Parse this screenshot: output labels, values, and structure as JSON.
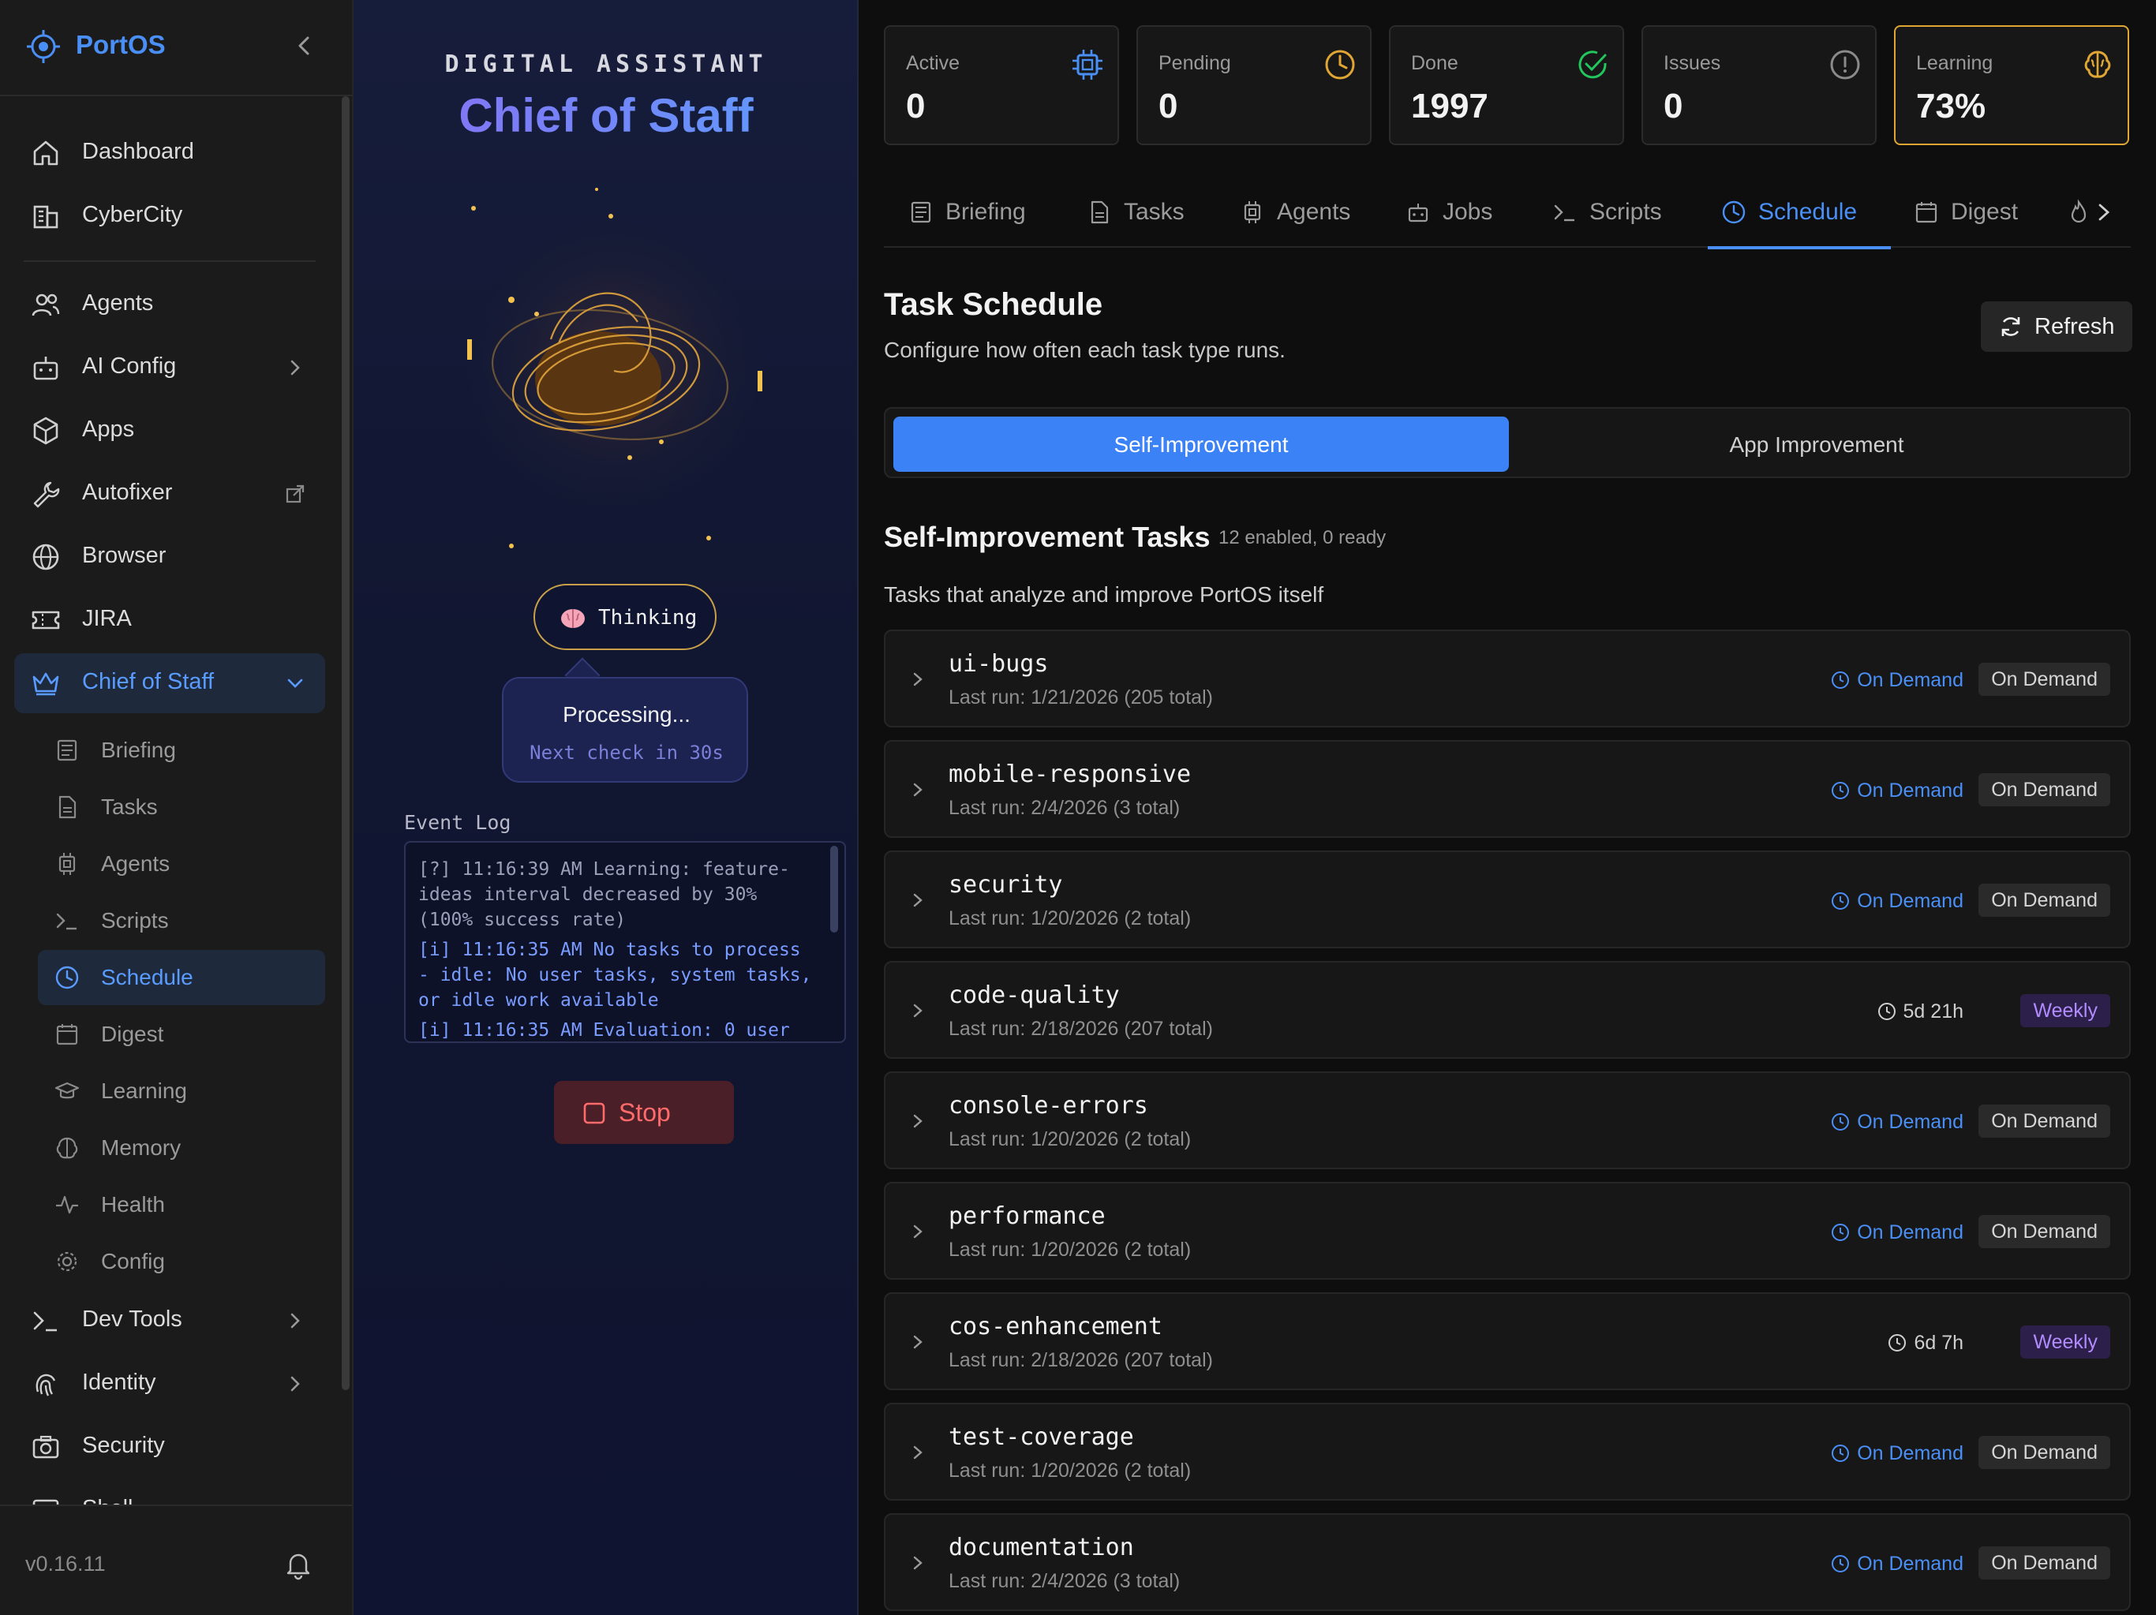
{
  "app": {
    "name": "PortOS",
    "version": "v0.16.11"
  },
  "sidebar": {
    "items": [
      {
        "label": "Dashboard",
        "icon": "home-icon"
      },
      {
        "label": "CyberCity",
        "icon": "building-icon"
      },
      {
        "label": "Agents",
        "icon": "users-icon"
      },
      {
        "label": "AI Config",
        "icon": "bot-icon"
      },
      {
        "label": "Apps",
        "icon": "package-icon"
      },
      {
        "label": "Autofixer",
        "icon": "wrench-icon"
      },
      {
        "label": "Browser",
        "icon": "globe-icon"
      },
      {
        "label": "JIRA",
        "icon": "ticket-icon"
      },
      {
        "label": "Chief of Staff",
        "icon": "crown-icon"
      },
      {
        "label": "Dev Tools",
        "icon": "terminal-icon"
      },
      {
        "label": "Identity",
        "icon": "fingerprint-icon"
      },
      {
        "label": "Security",
        "icon": "camera-icon"
      },
      {
        "label": "Shell",
        "icon": "terminal-window-icon"
      }
    ],
    "sub_items": [
      {
        "label": "Briefing",
        "icon": "newspaper-icon"
      },
      {
        "label": "Tasks",
        "icon": "file-icon"
      },
      {
        "label": "Agents",
        "icon": "cpu-icon"
      },
      {
        "label": "Scripts",
        "icon": "terminal-icon"
      },
      {
        "label": "Schedule",
        "icon": "clock-icon"
      },
      {
        "label": "Digest",
        "icon": "calendar-icon"
      },
      {
        "label": "Learning",
        "icon": "graduation-cap-icon"
      },
      {
        "label": "Memory",
        "icon": "brain-icon"
      },
      {
        "label": "Health",
        "icon": "activity-icon"
      },
      {
        "label": "Config",
        "icon": "gear-icon"
      }
    ]
  },
  "assistant": {
    "kicker": "DIGITAL ASSISTANT",
    "title": "Chief of Staff",
    "state": "Thinking",
    "bubble_title": "Processing...",
    "bubble_sub": "Next check in 30s",
    "log_label": "Event Log",
    "log": [
      {
        "kind": "learning",
        "text": "[?] 11:16:39 AM Learning: feature-ideas interval decreased by 30% (100% success rate)"
      },
      {
        "kind": "info",
        "text": "[i] 11:16:35 AM No tasks to process - idle: No user tasks, system tasks, or idle work available"
      },
      {
        "kind": "info",
        "text": "[i] 11:16:35 AM Evaluation: 0 user"
      }
    ],
    "stop_label": "Stop"
  },
  "stats": [
    {
      "label": "Active",
      "value": "0",
      "icon": "cpu-icon",
      "color": "#4a8ff5"
    },
    {
      "label": "Pending",
      "value": "0",
      "icon": "clock-icon",
      "color": "#e0a634"
    },
    {
      "label": "Done",
      "value": "1997",
      "icon": "check-circle-icon",
      "color": "#22c55e"
    },
    {
      "label": "Issues",
      "value": "0",
      "icon": "alert-circle-icon",
      "color": "#8a8a8a"
    },
    {
      "label": "Learning",
      "value": "73%",
      "icon": "brain-icon",
      "color": "#e0a634"
    }
  ],
  "tabs": [
    {
      "label": "Briefing"
    },
    {
      "label": "Tasks"
    },
    {
      "label": "Agents"
    },
    {
      "label": "Jobs"
    },
    {
      "label": "Scripts"
    },
    {
      "label": "Schedule"
    },
    {
      "label": "Digest"
    }
  ],
  "schedule": {
    "title": "Task Schedule",
    "subtitle": "Configure how often each task type runs.",
    "refresh_label": "Refresh",
    "segments": [
      "Self-Improvement",
      "App Improvement"
    ],
    "section_title": "Self-Improvement Tasks",
    "section_meta": "12 enabled, 0 ready",
    "section_desc": "Tasks that analyze and improve PortOS itself",
    "tasks": [
      {
        "name": "ui-bugs",
        "last": "Last run: 1/21/2026 (205 total)",
        "next": "On Demand",
        "badge": "On Demand"
      },
      {
        "name": "mobile-responsive",
        "last": "Last run: 2/4/2026 (3 total)",
        "next": "On Demand",
        "badge": "On Demand"
      },
      {
        "name": "security",
        "last": "Last run: 1/20/2026 (2 total)",
        "next": "On Demand",
        "badge": "On Demand"
      },
      {
        "name": "code-quality",
        "last": "Last run: 2/18/2026 (207 total)",
        "next": "5d 21h",
        "badge": "Weekly"
      },
      {
        "name": "console-errors",
        "last": "Last run: 1/20/2026 (2 total)",
        "next": "On Demand",
        "badge": "On Demand"
      },
      {
        "name": "performance",
        "last": "Last run: 1/20/2026 (2 total)",
        "next": "On Demand",
        "badge": "On Demand"
      },
      {
        "name": "cos-enhancement",
        "last": "Last run: 2/18/2026 (207 total)",
        "next": "6d 7h",
        "badge": "Weekly"
      },
      {
        "name": "test-coverage",
        "last": "Last run: 1/20/2026 (2 total)",
        "next": "On Demand",
        "badge": "On Demand"
      },
      {
        "name": "documentation",
        "last": "Last run: 2/4/2026 (3 total)",
        "next": "On Demand",
        "badge": "On Demand"
      }
    ]
  }
}
